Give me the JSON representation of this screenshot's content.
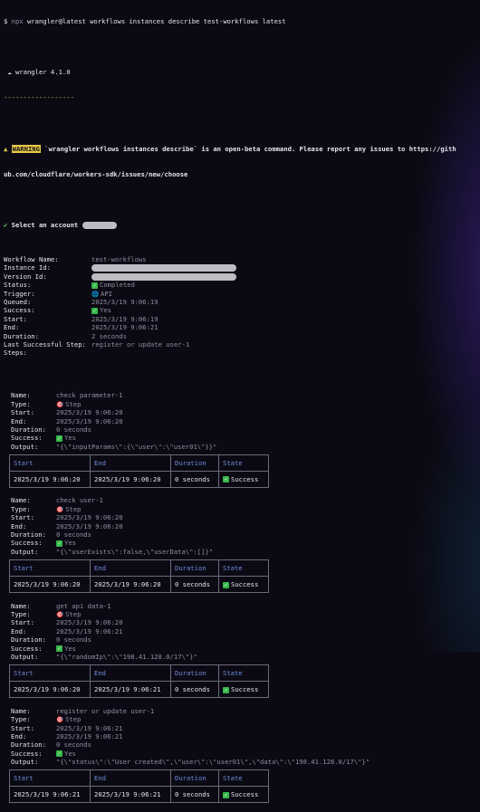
{
  "prompt": {
    "symbol": "$",
    "npx": "npx",
    "command": "wrangler@latest workflows instances describe test-workflows latest"
  },
  "banner": {
    "icon": "cloud-icon",
    "text": "wrangler 4.1.0",
    "rule": "------------------"
  },
  "warning": {
    "badge": "WARNING",
    "line1": "`wrangler workflows instances describe` is an open-beta command. Please report any issues to https://gith",
    "line2": "ub.com/cloudflare/workers-sdk/issues/new/choose"
  },
  "select": {
    "check": "✔",
    "label": "Select an account"
  },
  "details": [
    {
      "key": "Workflow Name:",
      "value": "test-workflows",
      "redacted": false
    },
    {
      "key": "Instance Id:",
      "value": "",
      "redacted": true
    },
    {
      "key": "Version Id:",
      "value": "",
      "redacted": true
    },
    {
      "key": "Status:",
      "value": "Completed",
      "icon": "check"
    },
    {
      "key": "Trigger:",
      "value": "API",
      "icon": "globe"
    },
    {
      "key": "Queued:",
      "value": "2025/3/19 9:06:19"
    },
    {
      "key": "Success:",
      "value": "Yes",
      "icon": "check"
    },
    {
      "key": "Start:",
      "value": "2025/3/19 9:06:19"
    },
    {
      "key": "End:",
      "value": "2025/3/19 9:06:21"
    },
    {
      "key": "Duration:",
      "value": "2 seconds"
    },
    {
      "key": "Last Successful Step:",
      "value": "register or update user-1"
    },
    {
      "key": "Steps:",
      "value": ""
    }
  ],
  "labels": {
    "name": "Name:",
    "type": "Type:",
    "start": "Start:",
    "end": "End:",
    "duration": "Duration:",
    "success": "Success:",
    "output": "Output:",
    "step_type": "Step",
    "yes": "Yes",
    "col_start": "Start",
    "col_end": "End",
    "col_duration": "Duration",
    "col_state": "State",
    "state_success": "Success"
  },
  "steps": [
    {
      "name": "check parameter-1",
      "start": "2025/3/19 9:06:20",
      "end": "2025/3/19 9:06:20",
      "duration": "0 seconds",
      "output": "\"{\\\"inputParams\\\":{\\\"user\\\":\\\"user01\\\"}}\"",
      "row_start": "2025/3/19 9:06:20",
      "row_end": "2025/3/19 9:06:20",
      "row_duration": "0 seconds"
    },
    {
      "name": "check user-1",
      "start": "2025/3/19 9:06:20",
      "end": "2025/3/19 9:06:20",
      "duration": "0 seconds",
      "output": "\"{\\\"userExists\\\":false,\\\"userData\\\":[]}\"",
      "row_start": "2025/3/19 9:06:20",
      "row_end": "2025/3/19 9:06:20",
      "row_duration": "0 seconds"
    },
    {
      "name": "get api data-1",
      "start": "2025/3/19 9:06:20",
      "end": "2025/3/19 9:06:21",
      "duration": "0 seconds",
      "output": "\"{\\\"randomIp\\\":\\\"198.41.128.0/17\\\"}\"",
      "row_start": "2025/3/19 9:06:20",
      "row_end": "2025/3/19 9:06:21",
      "row_duration": "0 seconds"
    },
    {
      "name": "register or update user-1",
      "start": "2025/3/19 9:06:21",
      "end": "2025/3/19 9:06:21",
      "duration": "0 seconds",
      "output": "\"{\\\"status\\\":\\\"User created\\\",\\\"user\\\":\\\"user01\\\",\\\"data\\\":\\\"198.41.128.0/17\\\"}\"",
      "row_start": "2025/3/19 9:06:21",
      "row_end": "2025/3/19 9:06:21",
      "row_duration": "0 seconds"
    }
  ]
}
